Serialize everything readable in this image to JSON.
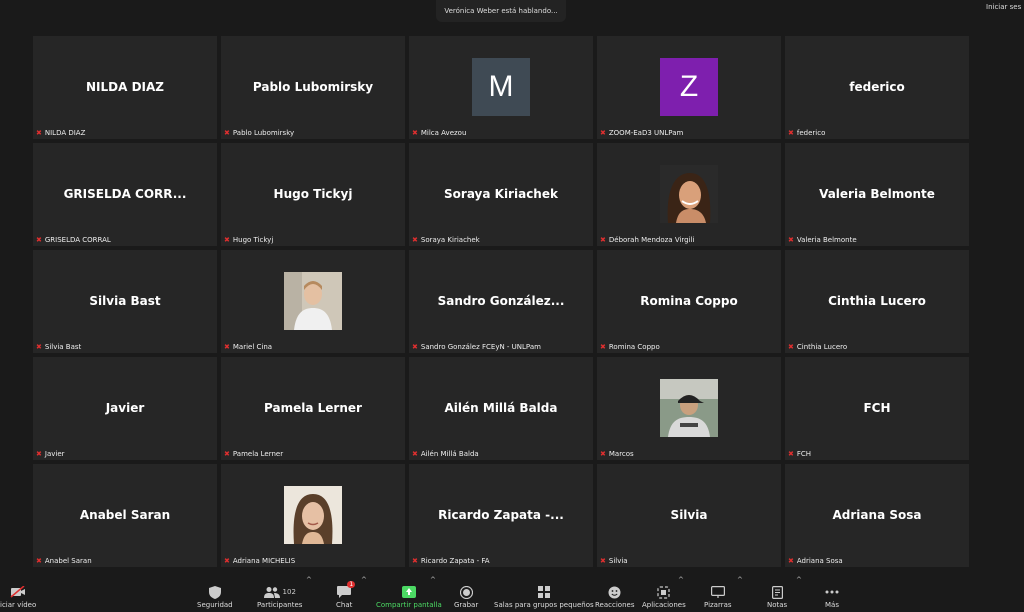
{
  "speaking_banner": "Verónica Weber está hablando...",
  "corner_label": "Iniciar ses",
  "tiles": [
    {
      "big": "NILDA DIAZ",
      "foot": "NILDA DIAZ",
      "type": "text"
    },
    {
      "big": "Pablo Lubomirsky",
      "foot": "Pablo Lubomirsky",
      "type": "text"
    },
    {
      "big": "M",
      "foot": "Milca Avezou",
      "type": "avatar",
      "color": "#3f4a54"
    },
    {
      "big": "Z",
      "foot": "ZOOM-EaD3 UNLPam",
      "type": "avatar",
      "color": "#7e1fae"
    },
    {
      "big": "federico",
      "foot": "federico",
      "type": "text"
    },
    {
      "big": "GRISELDA  CORR...",
      "foot": "GRISELDA CORRAL",
      "type": "text"
    },
    {
      "big": "Hugo Tickyj",
      "foot": "Hugo Tickyj",
      "type": "text"
    },
    {
      "big": "Soraya Kiriachek",
      "foot": "Soraya Kiriachek",
      "type": "text"
    },
    {
      "big": "",
      "foot": "Déborah Mendoza Virgili",
      "type": "photo"
    },
    {
      "big": "Valeria Belmonte",
      "foot": "Valeria Belmonte",
      "type": "text"
    },
    {
      "big": "Silvia Bast",
      "foot": "Silvia Bast",
      "type": "text"
    },
    {
      "big": "",
      "foot": "Mariel Cina",
      "type": "photo"
    },
    {
      "big": "Sandro  González...",
      "foot": "Sandro González FCEyN - UNLPam",
      "type": "text"
    },
    {
      "big": "Romina Coppo",
      "foot": "Romina Coppo",
      "type": "text"
    },
    {
      "big": "Cinthia Lucero",
      "foot": "Cinthia Lucero",
      "type": "text"
    },
    {
      "big": "Javier",
      "foot": "Javier",
      "type": "text"
    },
    {
      "big": "Pamela Lerner",
      "foot": "Pamela Lerner",
      "type": "text"
    },
    {
      "big": "Ailén Millá Balda",
      "foot": "Ailén Millá Balda",
      "type": "text"
    },
    {
      "big": "",
      "foot": "Marcos",
      "type": "photo"
    },
    {
      "big": "FCH",
      "foot": "FCH",
      "type": "text"
    },
    {
      "big": "Anabel Saran",
      "foot": "Anabel Saran",
      "type": "text"
    },
    {
      "big": "",
      "foot": "Adriana MICHELIS",
      "type": "photo"
    },
    {
      "big": "Ricardo Zapata  -...",
      "foot": "Ricardo Zapata - FA",
      "type": "text"
    },
    {
      "big": "Silvia",
      "foot": "Silvia",
      "type": "text"
    },
    {
      "big": "Adriana Sosa",
      "foot": "Adriana Sosa",
      "type": "text"
    }
  ],
  "toolbar": {
    "video": "iciar vídeo",
    "security": "Seguridad",
    "participants": "Participantes",
    "participants_count": "102",
    "chat": "Chat",
    "chat_badge": "1",
    "share": "Compartir pantalla",
    "record": "Grabar",
    "breakout": "Salas para grupos pequeños",
    "reactions": "Reacciones",
    "apps": "Aplicaciones",
    "whiteboards": "Pizarras",
    "notes": "Notas",
    "more": "Más"
  },
  "colors": {
    "mute": "#e02f2f",
    "share": "#4cd964",
    "tile": "#262626",
    "background": "#1a1a1a"
  }
}
